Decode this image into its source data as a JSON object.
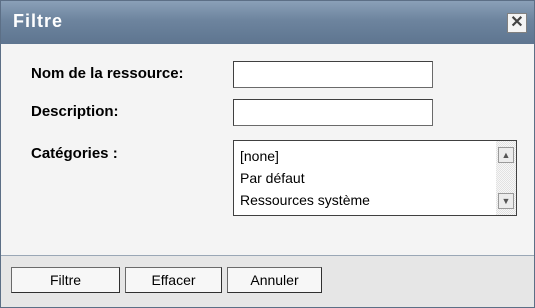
{
  "dialog": {
    "title": "Filtre",
    "close_glyph": "✕"
  },
  "form": {
    "resource_name_label": "Nom de la ressource:",
    "resource_name_value": "",
    "description_label": "Description:",
    "description_value": "",
    "categories_label": "Catégories :",
    "categories": [
      "[none]",
      "Par défaut",
      "Ressources système"
    ]
  },
  "buttons": {
    "filter": "Filtre",
    "clear": "Effacer",
    "cancel": "Annuler"
  },
  "icons": {
    "close": "close-icon",
    "scroll_up": "scroll-up-arrow-icon",
    "scroll_down": "scroll-down-arrow-icon"
  }
}
